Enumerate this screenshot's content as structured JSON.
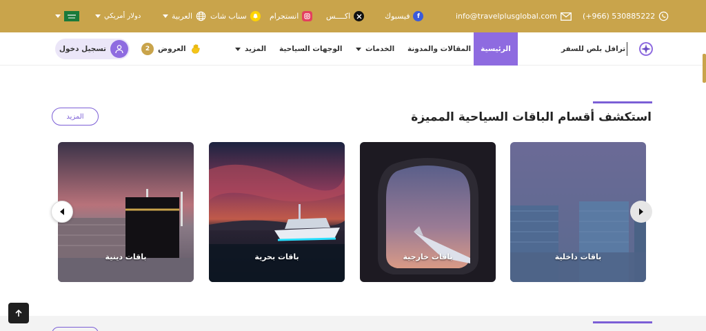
{
  "topbar": {
    "phone": "(+966) 530885222",
    "email": "info@travelplusglobal.com",
    "facebook": "فيسبوك",
    "x": "اكــــس",
    "instagram": "انستجرام",
    "snapchat": "سناب شات",
    "language": "العربية",
    "currency": "دولار أمريكي"
  },
  "header": {
    "brand": "ترافل بلص للسفر",
    "nav": {
      "home": "الرئيسية",
      "articles": "المقالات والمدونة",
      "services": "الخدمات",
      "destinations": "الوجهات السياحية",
      "more": "المزيد"
    },
    "offers_label": "العروض",
    "offers_count": "2",
    "login": "تسجيل دخول"
  },
  "section": {
    "title": "استكشف أقسام الباقات السياحية المميزة",
    "more_button": "المزيد",
    "cards": [
      {
        "label": "باقات داخلية"
      },
      {
        "label": "باقات خارجية"
      },
      {
        "label": "باقات بحرية"
      },
      {
        "label": "باقات دينية"
      }
    ]
  },
  "colors": {
    "gold": "#c9a44b",
    "purple": "#8e6be0",
    "line": "#7b5ed6"
  }
}
